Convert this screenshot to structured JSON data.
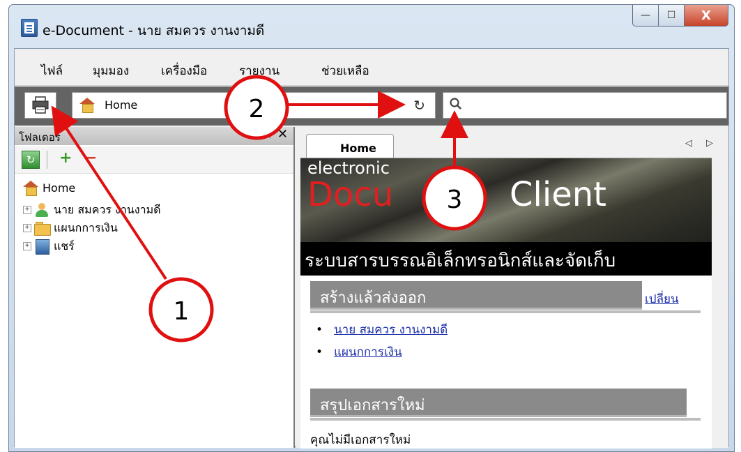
{
  "window": {
    "title": "e-Document - นาย สมควร งานงามดี",
    "controls": {
      "minimize": "—",
      "maximize": "☐",
      "close": "X"
    }
  },
  "menu": [
    "ไฟล์",
    "มุมมอง",
    "เครื่องมือ",
    "รายงาน",
    "ช่วยเหลือ"
  ],
  "toolbar": {
    "address": "Home",
    "refresh_glyph": "↻",
    "search_glyph": "⚲",
    "search_value": ""
  },
  "folders_panel": {
    "title": "โฟลเดอร์",
    "tools": "▾ ✕",
    "tree": [
      {
        "label": "Home",
        "icon": "home-icon"
      },
      {
        "label": "นาย สมควร งานงามดี",
        "icon": "user-icon"
      },
      {
        "label": "แผนกการเงิน",
        "icon": "folder-icon"
      },
      {
        "label": "แชร์",
        "icon": "share-icon"
      }
    ]
  },
  "tabs": [
    {
      "label": "Home"
    }
  ],
  "tab_arrows": "◁ ▷",
  "banner": {
    "line1": "electronic",
    "doc": "Docu",
    "client": "Client",
    "thai": "ระบบสารบรรณอิเล็กทรอนิกส์และจัดเก็บ"
  },
  "sections": {
    "outbox": {
      "title": "สร้างแล้วส่งออก",
      "change_link": "เปลี่ยน",
      "items": [
        "นาย สมควร งานงามดี",
        "แผนกการเงิน"
      ]
    },
    "new_docs": {
      "title": "สรุปเอกสารใหม่",
      "empty_text": "คุณไม่มีเอกสารใหม่"
    }
  },
  "callouts": [
    "1",
    "2",
    "3"
  ],
  "colors": {
    "callout": "#e01010",
    "toolbar": "#646464",
    "link": "#1a2ea8",
    "section": "#8a8a8a"
  }
}
